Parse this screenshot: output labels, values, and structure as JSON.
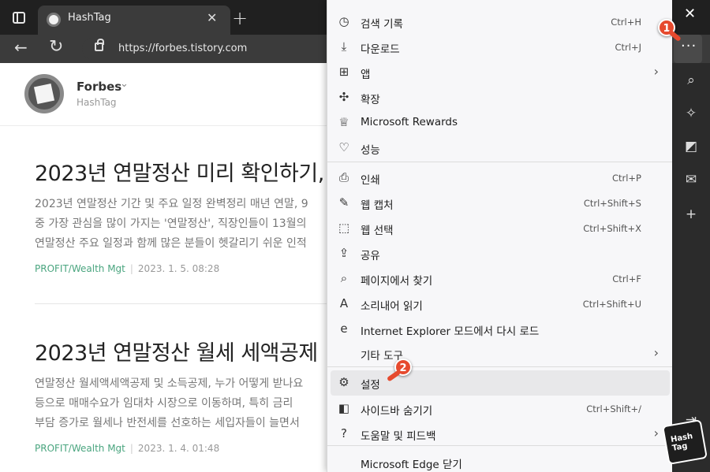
{
  "tab": {
    "title": "HashTag"
  },
  "address": {
    "url": "https://forbes.tistory.com"
  },
  "toolbar": {
    "more_label": "···"
  },
  "blog": {
    "name": "Forbes",
    "subtitle": "HashTag"
  },
  "posts": [
    {
      "title": "2023년 연말정산 미리 확인하기,",
      "desc": [
        "2023년 연말정산 기간 및 주요 일정 완벽정리 매년 연말, 9",
        "중 가장 관심을 많이 가지는 '연말정산', 직장인들이 13월의",
        "연말정산 주요 일정과 함께 많은 분들이 헷갈리기 쉬운 인적"
      ],
      "category": "PROFIT/Wealth Mgt",
      "date": "2023. 1. 5. 08:28"
    },
    {
      "title": "2023년 연말정산 월세 세액공제",
      "desc": [
        "연말정산 월세액세액공제 및 소득공제, 누가 어떻게 받나요",
        "등으로 매매수요가 임대차 시장으로 이동하며, 특히 금리",
        "부담 증가로 월세나 반전세를 선호하는 세입자들이 늘면서"
      ],
      "category": "PROFIT/Wealth Mgt",
      "date": "2023. 1. 4. 01:48"
    }
  ],
  "menu": {
    "items": [
      {
        "label": "검색 기록",
        "shortcut": "Ctrl+H",
        "icon": "history-icon",
        "glyph": "◷"
      },
      {
        "label": "다운로드",
        "shortcut": "Ctrl+J",
        "icon": "download-icon",
        "glyph": "⤓"
      },
      {
        "label": "앱",
        "shortcut": "",
        "icon": "apps-icon",
        "glyph": "⊞",
        "arrow": "›"
      },
      {
        "label": "확장",
        "shortcut": "",
        "icon": "extensions-icon",
        "glyph": "✣"
      },
      {
        "label": "Microsoft Rewards",
        "shortcut": "",
        "icon": "rewards-icon",
        "glyph": "♕"
      },
      {
        "label": "성능",
        "shortcut": "",
        "icon": "performance-icon",
        "glyph": "♡"
      },
      {
        "label": "인쇄",
        "shortcut": "Ctrl+P",
        "icon": "print-icon",
        "glyph": "⎙"
      },
      {
        "label": "웹 캡처",
        "shortcut": "Ctrl+Shift+S",
        "icon": "web-capture-icon",
        "glyph": "✎"
      },
      {
        "label": "웹 선택",
        "shortcut": "Ctrl+Shift+X",
        "icon": "web-select-icon",
        "glyph": "⬚"
      },
      {
        "label": "공유",
        "shortcut": "",
        "icon": "share-icon",
        "glyph": "⇪"
      },
      {
        "label": "페이지에서 찾기",
        "shortcut": "Ctrl+F",
        "icon": "find-icon",
        "glyph": "⌕"
      },
      {
        "label": "소리내어 읽기",
        "shortcut": "Ctrl+Shift+U",
        "icon": "read-aloud-icon",
        "glyph": "A"
      },
      {
        "label": "Internet Explorer 모드에서 다시 로드",
        "shortcut": "",
        "icon": "ie-mode-icon",
        "glyph": "e"
      },
      {
        "label": "기타 도구",
        "shortcut": "",
        "icon": "more-tools-icon",
        "glyph": "",
        "arrow": "›"
      },
      {
        "label": "설정",
        "shortcut": "",
        "icon": "settings-icon",
        "glyph": "⚙"
      },
      {
        "label": "사이드바 숨기기",
        "shortcut": "Ctrl+Shift+/",
        "icon": "sidebar-icon",
        "glyph": "◧"
      },
      {
        "label": "도움말 및 피드백",
        "shortcut": "",
        "icon": "help-icon",
        "glyph": "?",
        "arrow": "›"
      },
      {
        "label": "Microsoft Edge 닫기",
        "shortcut": "",
        "icon": "close-edge-icon",
        "glyph": ""
      }
    ]
  },
  "badges": {
    "one": "1",
    "two": "2"
  },
  "watermark": {
    "line1": "Hash",
    "line2": "Tag"
  },
  "colors": {
    "badge": "#e64a2e",
    "category": "#4aa57f"
  }
}
